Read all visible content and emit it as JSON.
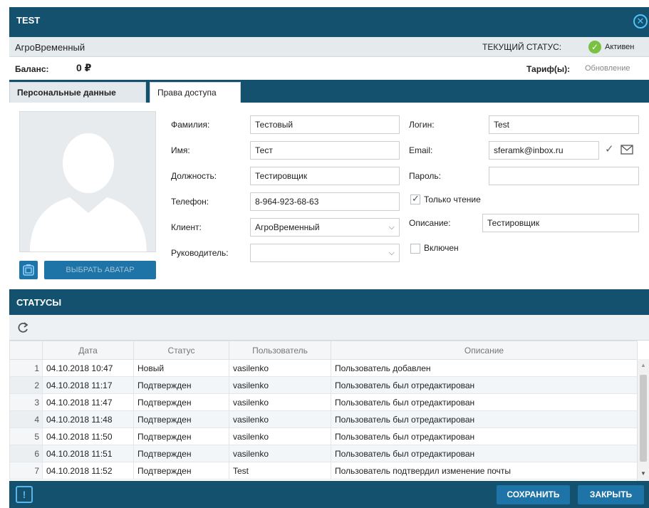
{
  "window": {
    "title": "TEST"
  },
  "header": {
    "name": "АгроВременный",
    "status_label": "ТЕКУЩИЙ СТАТУС:",
    "status_value": "Активен",
    "balance_label": "Баланс:",
    "balance_value": "0 ₽",
    "tariff_label": "Тариф(ы):",
    "tariff_value": "Обновление"
  },
  "tabs": [
    {
      "label": "Персональные данные",
      "active": true
    },
    {
      "label": "Права доступа",
      "active": false
    }
  ],
  "form": {
    "lastname_label": "Фамилия:",
    "lastname_value": "Тестовый",
    "firstname_label": "Имя:",
    "firstname_value": "Тест",
    "position_label": "Должность:",
    "position_value": "Тестировщик",
    "phone_label": "Телефон:",
    "phone_value": "8-964-923-68-63",
    "client_label": "Клиент:",
    "client_value": "АгроВременный",
    "manager_label": "Руководитель:",
    "manager_value": "",
    "login_label": "Логин:",
    "login_value": "Test",
    "email_label": "Email:",
    "email_value": "sferamk@inbox.ru",
    "password_label": "Пароль:",
    "password_value": "",
    "readonly_label": "Только чтение",
    "readonly_checked": true,
    "description_label": "Описание:",
    "description_value": "Тестировщик",
    "enabled_label": "Включен",
    "enabled_checked": false,
    "avatar_button": "ВЫБРАТЬ АВАТАР"
  },
  "statuses": {
    "title": "СТАТУСЫ",
    "columns": [
      "Дата",
      "Статус",
      "Пользователь",
      "Описание"
    ],
    "rows": [
      [
        "1",
        "04.10.2018 10:47",
        "Новый",
        "vasilenko",
        "Пользователь добавлен"
      ],
      [
        "2",
        "04.10.2018 11:17",
        "Подтвержден",
        "vasilenko",
        "Пользователь был отредактирован"
      ],
      [
        "3",
        "04.10.2018 11:47",
        "Подтвержден",
        "vasilenko",
        "Пользователь был отредактирован"
      ],
      [
        "4",
        "04.10.2018 11:48",
        "Подтвержден",
        "vasilenko",
        "Пользователь был отредактирован"
      ],
      [
        "5",
        "04.10.2018 11:50",
        "Подтвержден",
        "vasilenko",
        "Пользователь был отредактирован"
      ],
      [
        "6",
        "04.10.2018 11:51",
        "Подтвержден",
        "vasilenko",
        "Пользователь был отредактирован"
      ],
      [
        "7",
        "04.10.2018 11:52",
        "Подтвержден",
        "Test",
        "Пользователь подтвердил изменение почты"
      ]
    ]
  },
  "footer": {
    "save_label": "СОХРАНИТЬ",
    "close_label": "ЗАКРЫТЬ"
  },
  "colors": {
    "primary": "#14516f",
    "button": "#1e74a6",
    "accent": "#4fc3f7",
    "status_ok": "#7ac143"
  }
}
